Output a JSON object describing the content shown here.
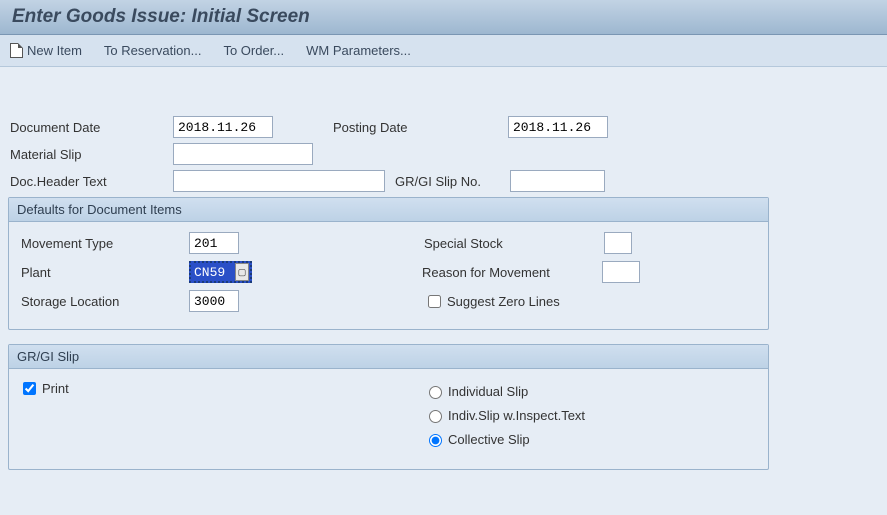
{
  "title": "Enter Goods Issue: Initial Screen",
  "toolbar": {
    "new_item": "New Item",
    "to_reservation": "To Reservation...",
    "to_order": "To Order...",
    "wm_parameters": "WM Parameters..."
  },
  "header": {
    "document_date_label": "Document Date",
    "document_date": "2018.11.26",
    "posting_date_label": "Posting Date",
    "posting_date": "2018.11.26",
    "material_slip_label": "Material Slip",
    "material_slip": "",
    "doc_header_text_label": "Doc.Header Text",
    "doc_header_text": "",
    "gr_gi_slip_no_label": "GR/GI Slip No.",
    "gr_gi_slip_no": ""
  },
  "defaults": {
    "group_title": "Defaults for Document Items",
    "movement_type_label": "Movement Type",
    "movement_type": "201",
    "special_stock_label": "Special Stock",
    "special_stock": "",
    "plant_label": "Plant",
    "plant": "CN59",
    "reason_label": "Reason for Movement",
    "reason": "",
    "storage_location_label": "Storage Location",
    "storage_location": "3000",
    "suggest_zero_label": "Suggest Zero Lines",
    "suggest_zero_checked": false
  },
  "slip": {
    "group_title": "GR/GI Slip",
    "print_label": "Print",
    "print_checked": true,
    "option_individual": "Individual Slip",
    "option_indiv_inspect": "Indiv.Slip w.Inspect.Text",
    "option_collective": "Collective Slip",
    "selected": "collective"
  }
}
